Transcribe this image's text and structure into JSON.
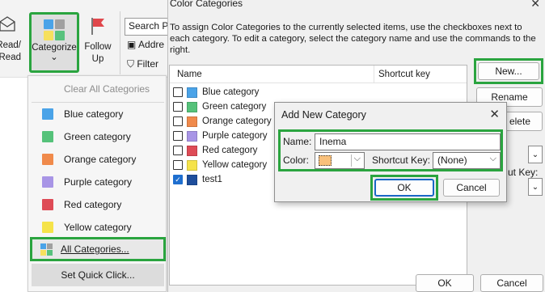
{
  "ribbon": {
    "read_unread_label": "Read/\nRead",
    "categorize_label": "Categorize",
    "categorize_chevron": "⌄",
    "follow_up_label": "Follow\nUp",
    "follow_up_chevron": "⌄",
    "search_placeholder": "Search P",
    "address_label": "Addre",
    "filter_label": "Filter",
    "categorize_icon_colors": [
      "#4aa3e8",
      "#a0a0a0",
      "#f6e05e",
      "#58c27d"
    ],
    "follow_up_flag_color": "#e0474c"
  },
  "menu": {
    "clear_all": "Clear All Categories",
    "items": [
      {
        "label": "Blue category",
        "color": "#4aa3e8"
      },
      {
        "label": "Green category",
        "color": "#55c27a"
      },
      {
        "label": "Orange category",
        "color": "#f08a4b"
      },
      {
        "label": "Purple category",
        "color": "#a895e6"
      },
      {
        "label": "Red category",
        "color": "#de4b56"
      },
      {
        "label": "Yellow category",
        "color": "#f5e34a"
      }
    ],
    "all_categories": "All Categories...",
    "set_quick_click": "Set Quick Click..."
  },
  "dialog": {
    "title": "Color Categories",
    "close": "✕",
    "instructions": "To assign Color Categories to the currently selected items, use the checkboxes next to each category.  To edit a category, select the category name and use the commands to the right.",
    "col_name": "Name",
    "col_shortcut": "Shortcut key",
    "categories": [
      {
        "label": "Blue category",
        "color": "#4aa3e8",
        "checked": false
      },
      {
        "label": "Green category",
        "color": "#55c27a",
        "checked": false
      },
      {
        "label": "Orange category",
        "color": "#f08a4b",
        "checked": false
      },
      {
        "label": "Purple category",
        "color": "#a895e6",
        "checked": false
      },
      {
        "label": "Red category",
        "color": "#de4b56",
        "checked": false
      },
      {
        "label": "Yellow category",
        "color": "#f5e34a",
        "checked": false
      },
      {
        "label": "test1",
        "color": "#1e4e9c",
        "checked": true
      }
    ],
    "new_button": "New...",
    "rename_button": "Rename",
    "delete_button_partial": "elete",
    "shortcut_key_partial": "ut Key:",
    "ok_button": "OK",
    "cancel_button": "Cancel"
  },
  "add_new": {
    "title": "Add New Category",
    "close": "✕",
    "name_label": "Name:",
    "name_value": "Inema",
    "color_label": "Color:",
    "color_value": "#f9c07a",
    "shortcut_label": "Shortcut Key:",
    "shortcut_value": "(None)",
    "ok_button": "OK",
    "cancel_button": "Cancel"
  },
  "highlight_color": "#2aa43f"
}
